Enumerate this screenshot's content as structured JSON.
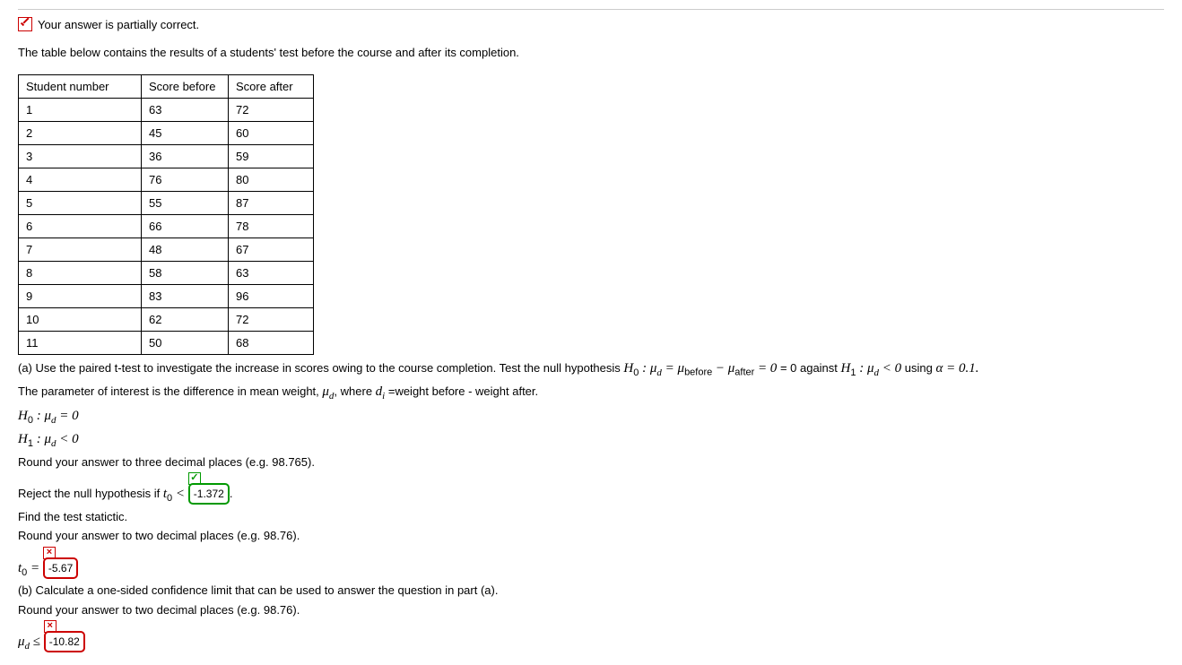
{
  "status": "Your answer is partially correct.",
  "intro": "The table below contains the results of a students' test before the course and after its completion.",
  "table": {
    "headers": [
      "Student number",
      "Score before",
      "Score after"
    ],
    "rows": [
      [
        "1",
        "63",
        "72"
      ],
      [
        "2",
        "45",
        "60"
      ],
      [
        "3",
        "36",
        "59"
      ],
      [
        "4",
        "76",
        "80"
      ],
      [
        "5",
        "55",
        "87"
      ],
      [
        "6",
        "66",
        "78"
      ],
      [
        "7",
        "48",
        "67"
      ],
      [
        "8",
        "58",
        "63"
      ],
      [
        "9",
        "83",
        "96"
      ],
      [
        "10",
        "62",
        "72"
      ],
      [
        "11",
        "50",
        "68"
      ]
    ]
  },
  "part_a_lead": "(a) Use the paired t-test to investigate the increase in scores owing to the course completion. Test the null hypothesis ",
  "hyp_tail": " using ",
  "alpha_eq": "α = 0.1.",
  "param_line_pre": "The parameter of interest is the difference in mean weight, ",
  "param_line_mid": ", where ",
  "param_line_post": " =weight before - weight after.",
  "round3": "Round your answer to three decimal places (e.g. 98.765).",
  "reject_pre": "Reject the null hypothesis if ",
  "reject_val": "-1.372",
  "find_stat": "Find the test statictic.",
  "round2": "Round your answer to two decimal places (e.g. 98.76).",
  "t0_val": "-5.67",
  "part_b": "(b) Calculate a one-sided confidence limit that can be used to answer the question in part (a).",
  "mu_val": "-10.82",
  "h0_text_pre": " = 0 against ",
  "zero_txt": " = 0",
  "lt_txt": " < 0"
}
